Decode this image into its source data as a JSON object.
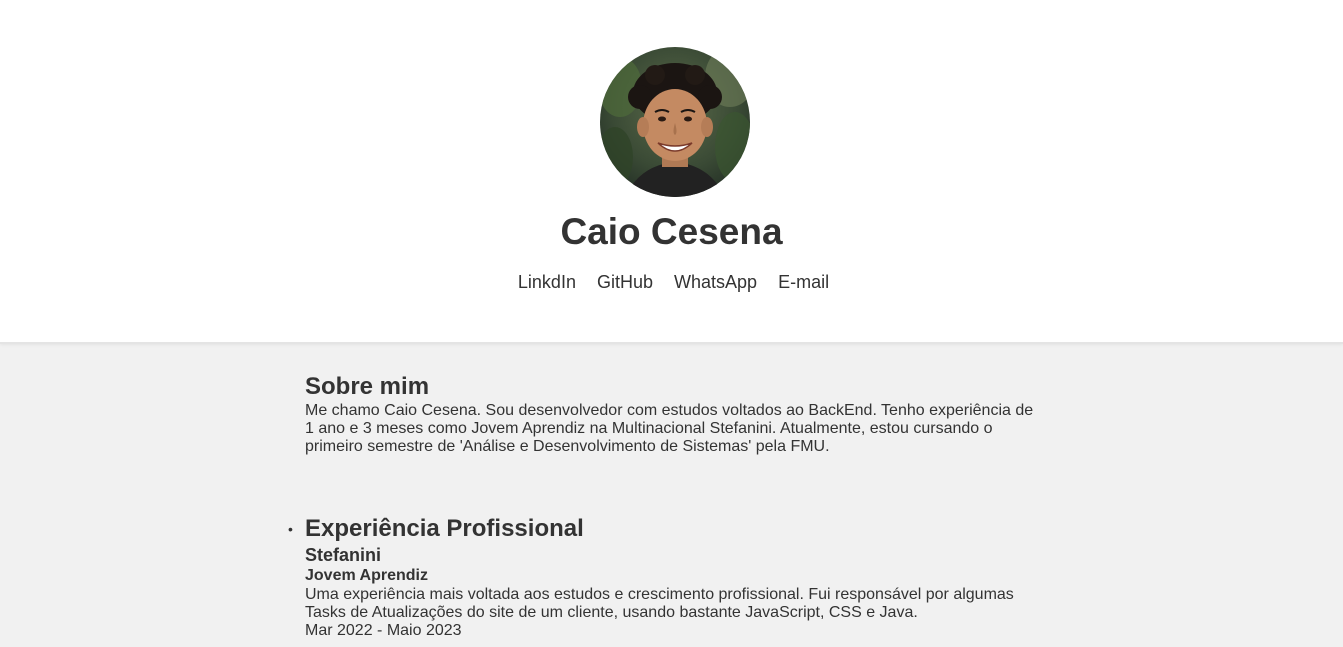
{
  "profile": {
    "name": "Caio Cesena",
    "avatar_icon": "profile-photo"
  },
  "links": [
    {
      "label": "LinkdIn"
    },
    {
      "label": "GitHub"
    },
    {
      "label": "WhatsApp"
    },
    {
      "label": "E-mail"
    }
  ],
  "about": {
    "title": "Sobre mim",
    "text": "Me chamo Caio Cesena. Sou desenvolvedor com estudos voltados ao BackEnd. Tenho experiência de 1 ano e 3 meses como Jovem Aprendiz na Multinacional Stefanini. Atualmente, estou cursando o primeiro semestre de 'Análise e Desenvolvimento de Sistemas' pela FMU."
  },
  "experience": {
    "title": "Experiência Profissional",
    "company": "Stefanini",
    "role": "Jovem Aprendiz",
    "description": "Uma experiência mais voltada aos estudos e crescimento profissional. Fui responsável por algumas Tasks de Atualizações do site de um cliente, usando bastante JavaScript, CSS e Java.",
    "period": "Mar 2022 - Maio 2023"
  },
  "colors": {
    "header_bg": "#ffffff",
    "page_bg": "#f1f1f1",
    "text": "#333333"
  }
}
